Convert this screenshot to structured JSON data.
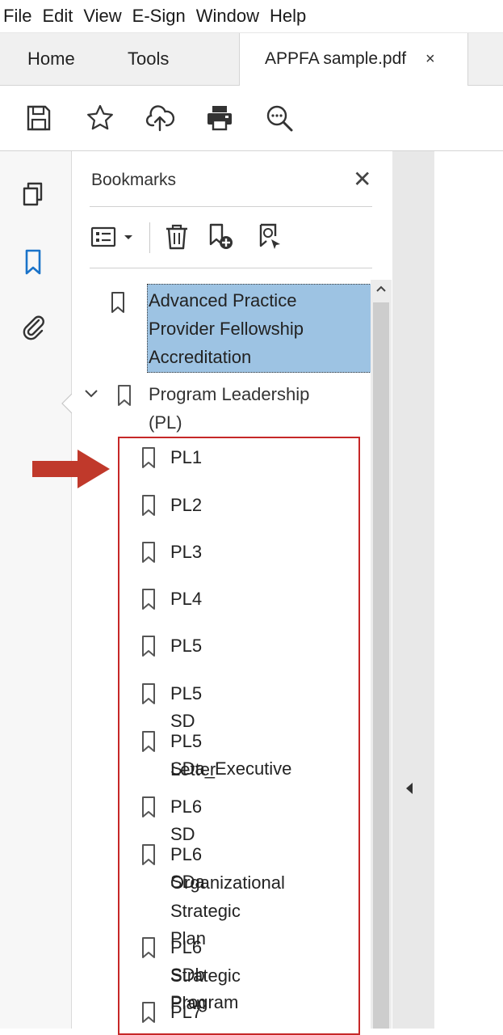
{
  "menubar": {
    "items": [
      "File",
      "Edit",
      "View",
      "E-Sign",
      "Window",
      "Help"
    ]
  },
  "tabs": {
    "home": "Home",
    "tools": "Tools",
    "document": "APPFA sample.pdf",
    "close": "×"
  },
  "toolbar": {
    "icons": [
      "save-icon",
      "star-icon",
      "cloud-upload-icon",
      "print-icon",
      "zoom-out-icon"
    ]
  },
  "left_strip": {
    "icons": [
      "pages-icon",
      "bookmark-icon",
      "attachment-icon"
    ]
  },
  "bookmarks_panel": {
    "title": "Bookmarks",
    "close": "✕",
    "toolbar_icons": [
      "options-menu-icon",
      "dropdown-icon",
      "delete-icon",
      "new-bookmark-icon",
      "find-bookmark-icon"
    ],
    "root": {
      "line1": "Advanced Practice",
      "line2": "Provider Fellowship",
      "line3": "Accreditation"
    },
    "group": {
      "line1": "Program Leadership",
      "line2": "(PL)"
    },
    "children": [
      {
        "line1": "PL1"
      },
      {
        "line1": "PL2"
      },
      {
        "line1": "PL3"
      },
      {
        "line1": "PL4"
      },
      {
        "line1": "PL5"
      },
      {
        "line1": "PL5 SD"
      },
      {
        "line1": "PL5 SDa_Executive",
        "line2": "Letter"
      },
      {
        "line1": "PL6 SD"
      },
      {
        "line1": "PL6 SDa",
        "line2": "Organizational",
        "line3": "Strategic Plan"
      },
      {
        "line1": "PL6 SDb Program",
        "line2": "Strategic Plan"
      },
      {
        "line1": "PL7"
      }
    ]
  },
  "colors": {
    "selection": "#9dc3e3",
    "highlight_box": "#c62828",
    "arrow": "#c0392b",
    "icon_blue": "#1a73c9"
  }
}
